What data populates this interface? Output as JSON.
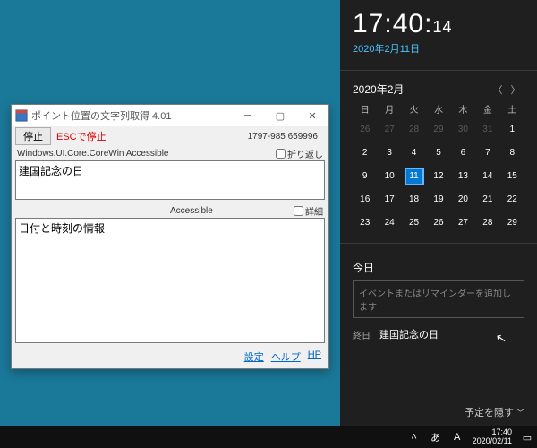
{
  "window": {
    "title": "ポイント位置の文字列取得 4.01",
    "stop_label": "停止",
    "esc_label": "ESCで停止",
    "coords": "1797-985   659996",
    "api_label": "Windows.UI.Core.CoreWin Accessible",
    "wrap_label": "折り返し",
    "text1": "建国記念の日",
    "mid_label": "Accessible",
    "detail_label": "詳細",
    "text2": "日付と時刻の情報",
    "settings": "設定",
    "help": "ヘルプ",
    "hp": "HP"
  },
  "flyout": {
    "time_h": "17",
    "time_m": "40",
    "time_s": "14",
    "date": "2020年2月11日",
    "month": "2020年2月",
    "dow": [
      "日",
      "月",
      "火",
      "水",
      "木",
      "金",
      "土"
    ],
    "leading_dim": [
      26,
      27,
      28,
      29,
      30,
      31
    ],
    "days": [
      1,
      2,
      3,
      4,
      5,
      6,
      7,
      8,
      9,
      10,
      11,
      12,
      13,
      14,
      15,
      16,
      17,
      18,
      19,
      20,
      21,
      22,
      23,
      24,
      25,
      26,
      27,
      28,
      29
    ],
    "today": 11,
    "today_header": "今日",
    "event_placeholder": "イベントまたはリマインダーを追加します",
    "allday": "終日",
    "holiday": "建国記念の日",
    "hide": "予定を隠す"
  },
  "taskbar": {
    "ime_hira": "あ",
    "ime_a": "A",
    "time": "17:40",
    "date": "2020/02/11"
  }
}
